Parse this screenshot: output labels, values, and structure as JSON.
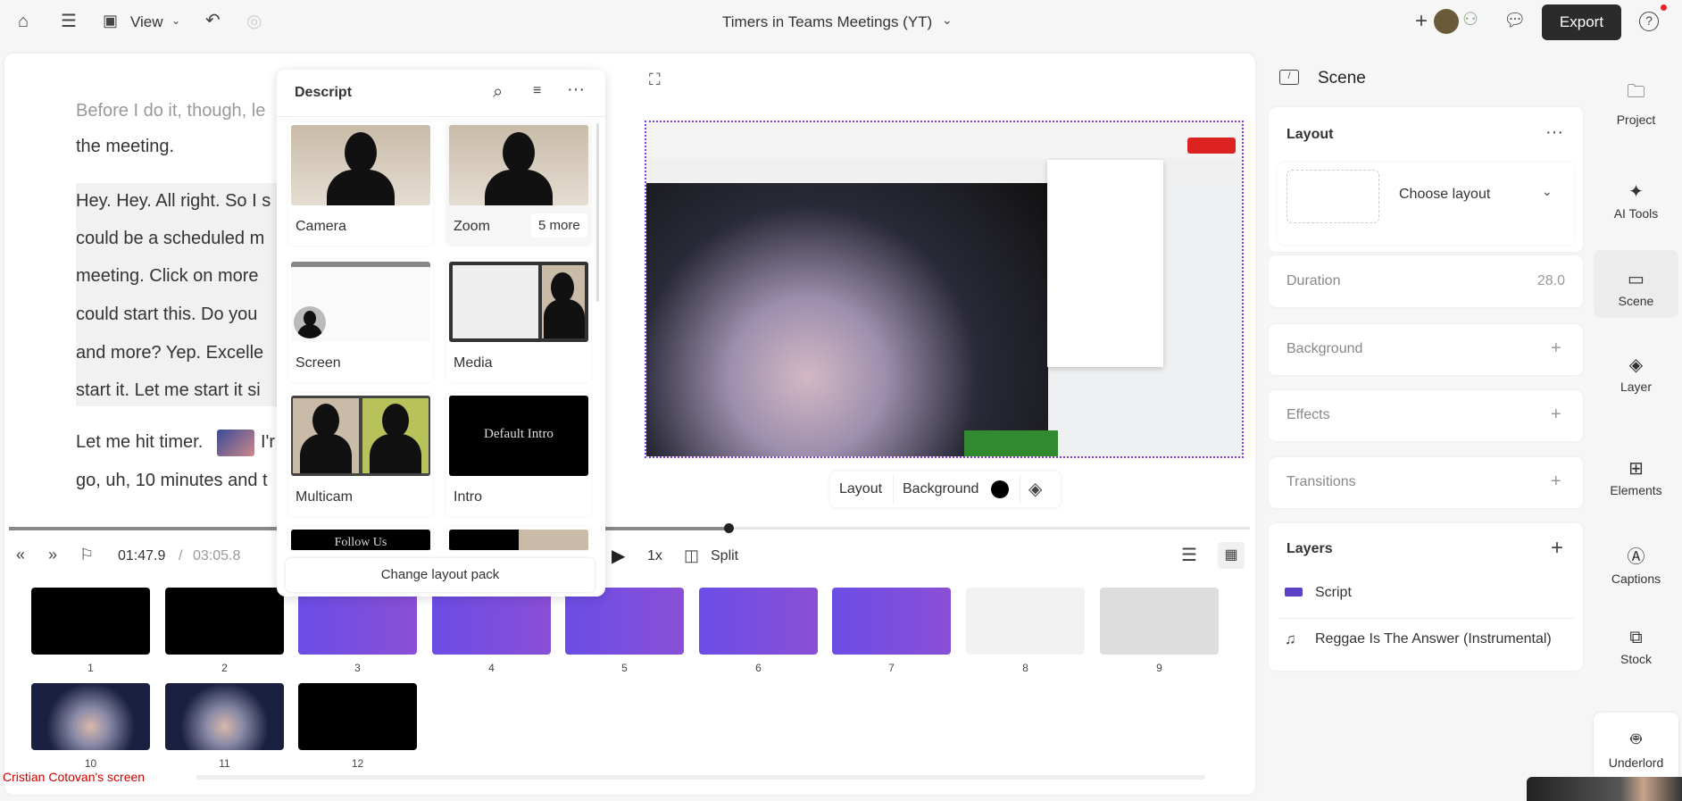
{
  "topbar": {
    "view_label": "View",
    "title": "Timers in Teams Meetings (YT)",
    "export_label": "Export"
  },
  "transcript": {
    "lines": [
      "Before I do it, though, le",
      "the meeting.",
      "Hey. Hey. All right. So I s",
      "could be a scheduled m",
      "meeting. Click on more",
      "could start this. Do you",
      "and more? Yep. Excelle",
      "start it. Let me start it si",
      "Let me hit timer.",
      "I'r",
      "go, uh, 10 minutes and t"
    ]
  },
  "layout_popup": {
    "title": "Descript",
    "cards": [
      {
        "label": "Camera"
      },
      {
        "label": "Zoom",
        "extra": "5 more"
      },
      {
        "label": "Screen"
      },
      {
        "label": "Media"
      },
      {
        "label": "Multicam"
      },
      {
        "label": "Intro",
        "thumb_text": "Default Intro"
      },
      {
        "thumb_text": "Follow Us"
      },
      {}
    ],
    "change_label": "Change layout pack"
  },
  "preview": {
    "layout_label": "Layout",
    "background_label": "Background",
    "background_color": "#000000",
    "selection_color": "#7b3fe4"
  },
  "playback": {
    "current_time": "01:47.9",
    "total_time": "03:05.8",
    "speed": "1x",
    "split_label": "Split",
    "progress": 0.58
  },
  "scenes": [
    "1",
    "2",
    "3",
    "4",
    "5",
    "6",
    "7",
    "8",
    "9",
    "10",
    "11",
    "12"
  ],
  "screen_share_label": "Cristian Cotovan's screen",
  "right_panel": {
    "title": "Scene",
    "layout": {
      "title": "Layout",
      "choose": "Choose layout"
    },
    "duration": {
      "label": "Duration",
      "value": "28.0"
    },
    "background": "Background",
    "effects": "Effects",
    "transitions": "Transitions",
    "layers": {
      "title": "Layers",
      "items": [
        "Script",
        "Reggae Is The Answer (Instrumental)"
      ]
    }
  },
  "rail": [
    "Project",
    "AI Tools",
    "Scene",
    "Layer",
    "Elements",
    "Captions",
    "Stock",
    "Underlord"
  ]
}
